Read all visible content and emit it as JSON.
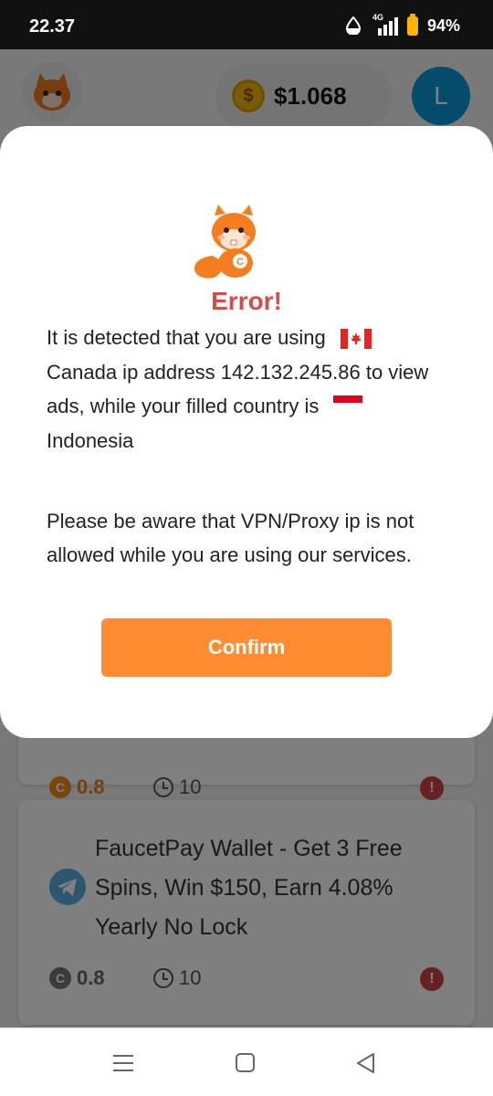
{
  "status_bar": {
    "time": "22.37",
    "network": "4G",
    "battery": "94%"
  },
  "header": {
    "balance": "$1.068",
    "coin_symbol": "$",
    "user_initial": "L"
  },
  "cards": [
    {
      "reward": "0.8",
      "duration": "10"
    },
    {
      "title": "FaucetPay Wallet - Get 3 Free Spins, Win $150, Earn 4.08% Yearly No Lock",
      "reward": "0.8",
      "duration": "10"
    }
  ],
  "dialog": {
    "title": "Error!",
    "message_part1": "It is detected that you are using",
    "message_part2": "Canada ip address 142.132.245.86 to view ads, while your filled country is",
    "message_part3": "Indonesia",
    "warning": "Please be aware that VPN/Proxy ip is not allowed while you are using our services.",
    "confirm_label": "Confirm"
  },
  "icons": {
    "coin": "coin-icon",
    "clock": "clock-icon",
    "info": "info-icon",
    "telegram": "telegram-icon",
    "flag_canada": "flag-canada-icon",
    "flag_indonesia": "flag-indonesia-icon"
  },
  "colors": {
    "accent": "#ff8c33",
    "error": "#d74b4b",
    "avatar": "#0a96d8",
    "coin": "#f6b613"
  }
}
